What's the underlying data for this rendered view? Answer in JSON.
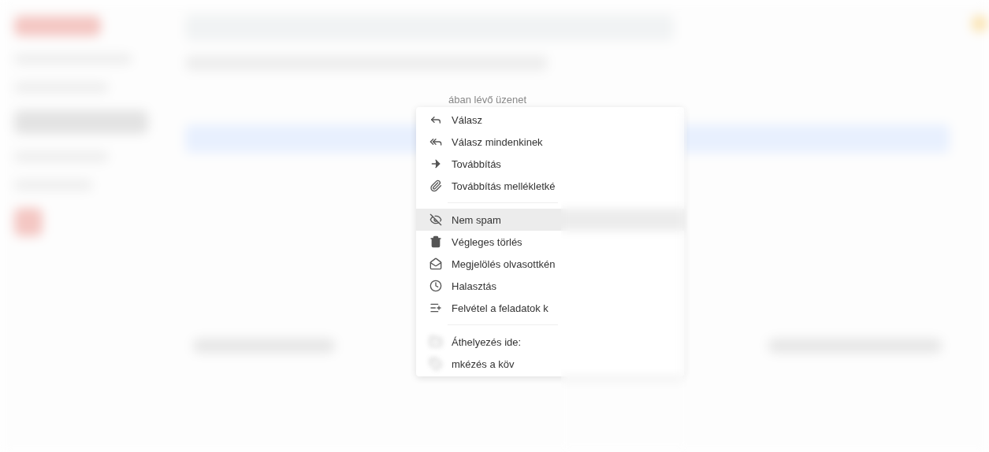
{
  "header_text": "ában lévő üzenet",
  "menu": {
    "sections": [
      [
        {
          "label": "Válasz",
          "selected": false
        },
        {
          "label": "Válasz mindenkinek",
          "selected": false
        },
        {
          "label": "Továbbítás",
          "selected": false
        },
        {
          "label": "Továbbítás mellékletké",
          "selected": false
        }
      ],
      [
        {
          "label": "Nem spam",
          "selected": true
        },
        {
          "label": "Végleges törlés",
          "selected": false
        },
        {
          "label": "Megjelölés olvasottkén",
          "selected": false
        },
        {
          "label": "Halasztás",
          "selected": false
        },
        {
          "label": "Felvétel a feladatok k",
          "selected": false
        }
      ],
      [
        {
          "label": "Áthelyezés ide:",
          "selected": false
        },
        {
          "label": "mkézés a köv",
          "selected": false
        }
      ]
    ]
  }
}
